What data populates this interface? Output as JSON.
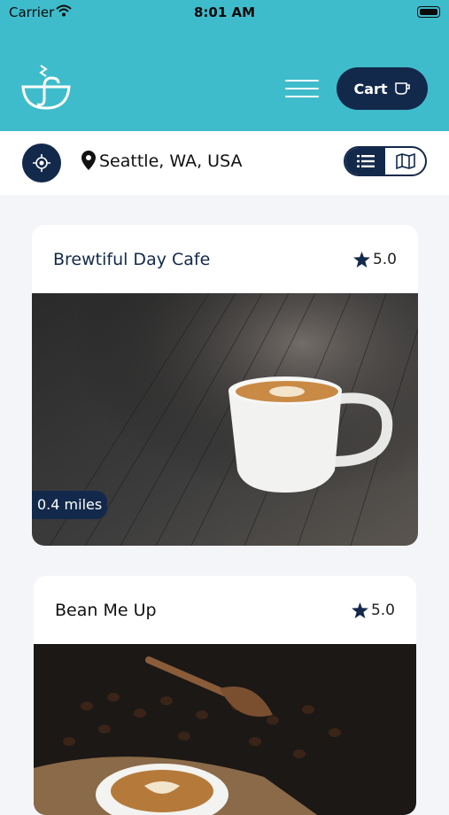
{
  "status": {
    "carrier": "Carrier",
    "time": "8:01 AM"
  },
  "header": {
    "cart_label": "Cart",
    "logo_icon": "cup-logo-icon",
    "menu_icon": "hamburger-icon",
    "cart_icon": "cup-icon"
  },
  "location": {
    "city": "Seattle, WA, USA",
    "locate_icon": "crosshair-icon",
    "pin_icon": "map-pin-icon"
  },
  "view_toggle": {
    "options": [
      "list",
      "map"
    ],
    "selected": "list"
  },
  "cafes": [
    {
      "name": "Brewtiful Day Cafe",
      "rating": "5.0",
      "distance": "0.4 miles"
    },
    {
      "name": "Bean Me Up",
      "rating": "5.0"
    }
  ],
  "colors": {
    "teal": "#3fbccb",
    "navy": "#13294b",
    "background": "#f4f5f8"
  }
}
